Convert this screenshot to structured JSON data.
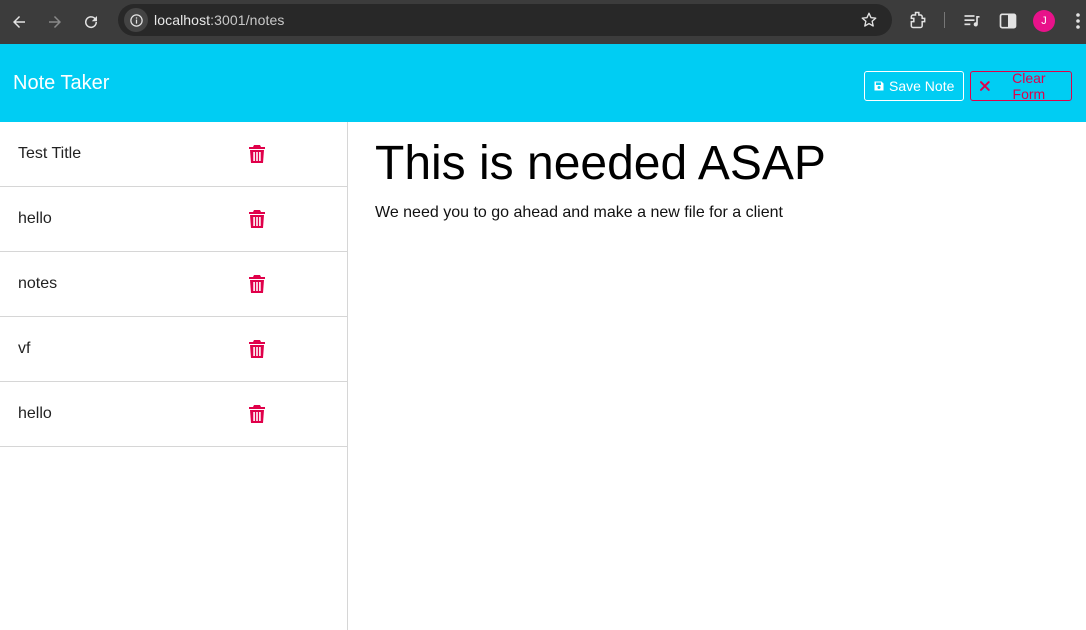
{
  "browser": {
    "url_host": "localhost",
    "url_path": ":3001/notes",
    "profile_initial": "J"
  },
  "navbar": {
    "brand": "Note Taker",
    "save_label": "Save Note",
    "clear_label": "Clear Form"
  },
  "notes": [
    {
      "title": "Test Title"
    },
    {
      "title": "hello"
    },
    {
      "title": "notes"
    },
    {
      "title": "vf"
    },
    {
      "title": "hello"
    }
  ],
  "active_note": {
    "title": "This is needed ASAP",
    "text": "We need you to go ahead and make a new file for a client"
  },
  "colors": {
    "navbar": "#00cdf3",
    "danger": "#e0004a",
    "chrome": "#3c3c3c"
  }
}
